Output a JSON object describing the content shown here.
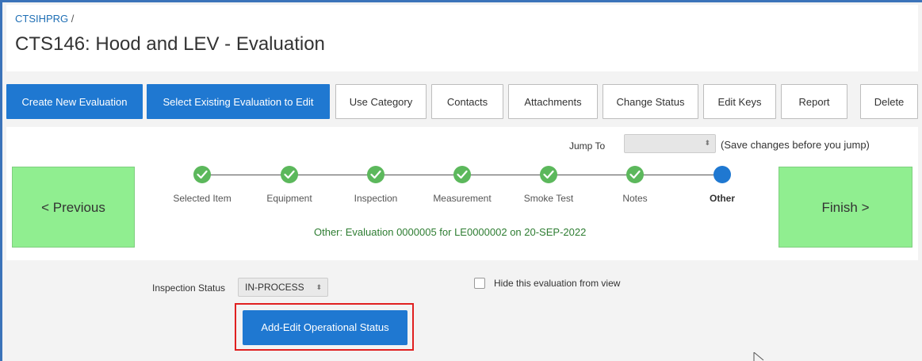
{
  "breadcrumb": {
    "root": "CTSIHPRG",
    "separator": "/"
  },
  "page": {
    "title": "CTS146: Hood and LEV - Evaluation"
  },
  "toolbar": {
    "create_new": "Create New Evaluation",
    "select_existing": "Select Existing Evaluation to Edit",
    "use_category": "Use Category",
    "contacts": "Contacts",
    "attachments": "Attachments",
    "change_status": "Change Status",
    "edit_keys": "Edit Keys",
    "report": "Report",
    "delete": "Delete"
  },
  "jump": {
    "label": "Jump To",
    "value": "",
    "hint": "(Save changes before you jump)"
  },
  "navigation": {
    "previous": "< Previous",
    "finish": "Finish >"
  },
  "steps": [
    {
      "label": "Selected Item",
      "state": "done"
    },
    {
      "label": "Equipment",
      "state": "done"
    },
    {
      "label": "Inspection",
      "state": "done"
    },
    {
      "label": "Measurement",
      "state": "done"
    },
    {
      "label": "Smoke Test",
      "state": "done"
    },
    {
      "label": "Notes",
      "state": "done"
    },
    {
      "label": "Other",
      "state": "current"
    }
  ],
  "status_line": {
    "prefix": "Other:",
    "text": "Evaluation 0000005 for LE0000002 on 20-SEP-2022"
  },
  "form": {
    "inspection_status_label": "Inspection Status",
    "inspection_status_value": "IN-PROCESS",
    "hide_label": "Hide this evaluation from view",
    "hide_checked": false,
    "operational_button": "Add-Edit Operational Status"
  },
  "colors": {
    "primary": "#1f78d1",
    "success": "#5cb85c",
    "nav_green": "#90ee90",
    "highlight": "#e02020"
  }
}
